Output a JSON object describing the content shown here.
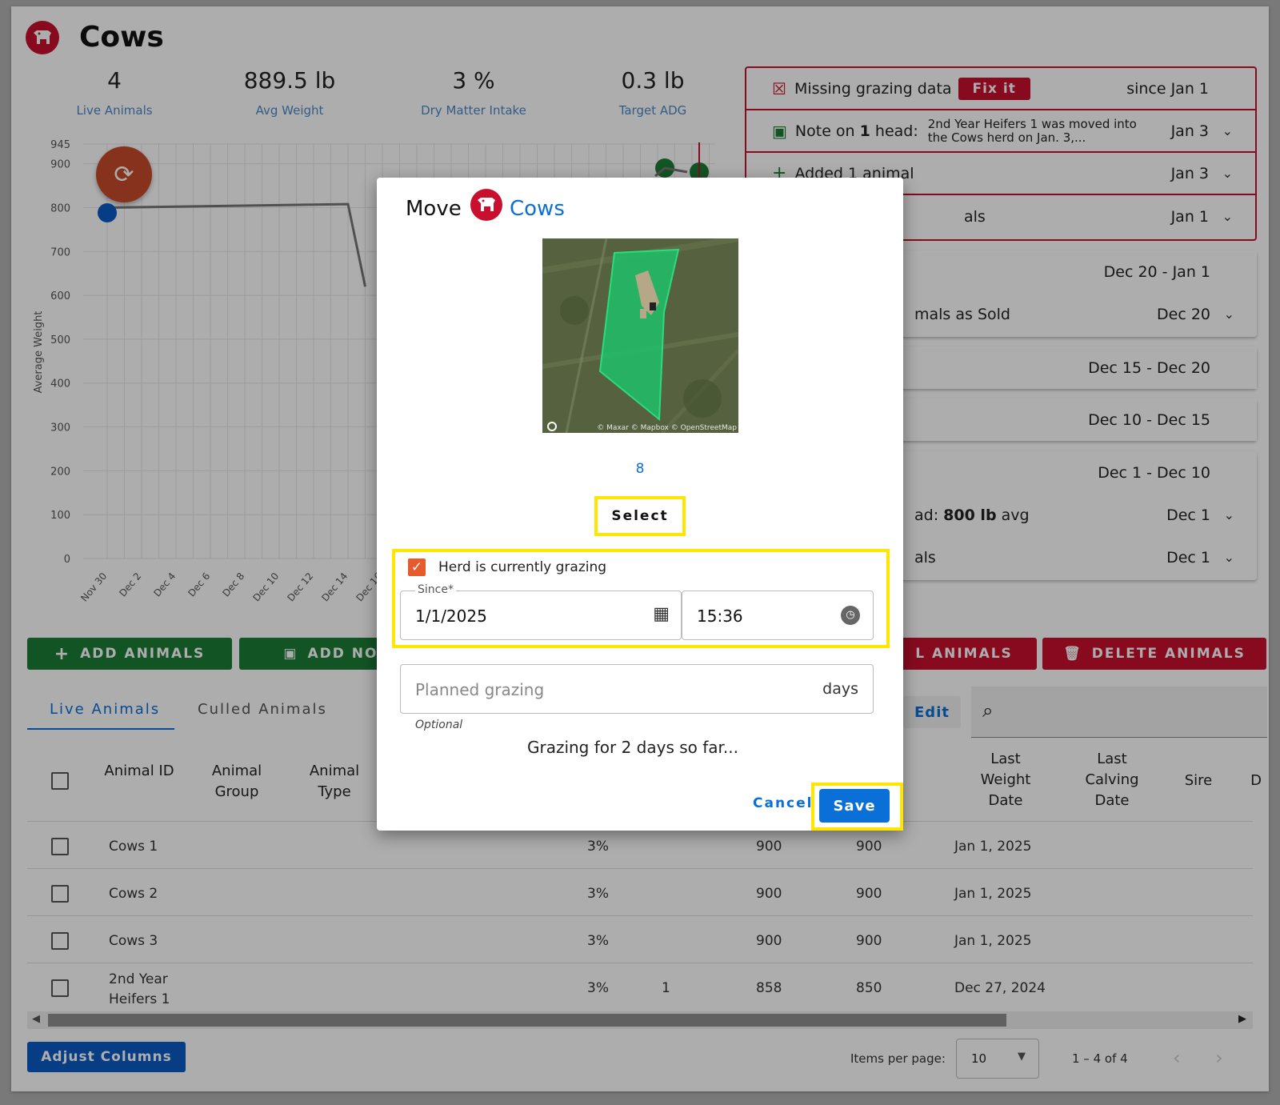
{
  "header": {
    "title": "Cows"
  },
  "stats": [
    {
      "value": "4",
      "label": "Live Animals"
    },
    {
      "value": "889.5 lb",
      "label": "Avg Weight"
    },
    {
      "value": "3 %",
      "label": "Dry Matter Intake"
    },
    {
      "value": "0.3 lb",
      "label": "Target ADG"
    }
  ],
  "chart": {
    "ylabel": "Average Weight",
    "yticks": [
      "945",
      "900",
      "800",
      "700",
      "600",
      "500",
      "400",
      "300",
      "200",
      "100",
      "0"
    ],
    "xticks": [
      "Nov 30",
      "Dec 2",
      "Dec 4",
      "Dec 6",
      "Dec 8",
      "Dec 10",
      "Dec 12",
      "Dec 14",
      "Dec 16"
    ]
  },
  "chart_data": {
    "type": "line",
    "ylabel": "Average Weight",
    "ylim": [
      0,
      945
    ],
    "x": [
      "Dec 1",
      "Dec 15",
      "Dec 16"
    ],
    "series": [
      {
        "values": [
          800,
          808,
          620
        ]
      }
    ]
  },
  "alerts": {
    "missing_label": "Missing grazing data",
    "fix_label": "Fix it",
    "missing_date": "since Jan 1",
    "note_prefix": "Note on ",
    "note_count": "1",
    "note_suffix": " head:",
    "note_text": "2nd Year Heifers 1 was moved into the Cows herd on Jan. 3,...",
    "note_date": "Jan 3",
    "added_label": "Added 1 animal",
    "added_date": "Jan 3",
    "row4_label": "als",
    "row4_date": "Jan 1"
  },
  "periods": [
    {
      "label": "",
      "date": "Dec 20 - Jan 1"
    },
    {
      "label": "mals as Sold",
      "date": "Dec 20"
    },
    {
      "label": "",
      "date": "Dec 15 - Dec 20"
    },
    {
      "label": "",
      "date": "Dec 10 - Dec 15"
    },
    {
      "label": "",
      "date": "Dec 1 - Dec 10"
    },
    {
      "label_pre": "ad: ",
      "label_bold": "800 lb",
      "label_post": " avg",
      "date": "Dec 1"
    },
    {
      "label": "als",
      "date": "Dec 1"
    }
  ],
  "actions": {
    "add_animals": "ADD ANIMALS",
    "add_notes": "ADD NOTE",
    "cull_animals": "L ANIMALS",
    "delete_animals": "DELETE ANIMALS",
    "edit": "Edit"
  },
  "tabs": {
    "live": "Live Animals",
    "culled": "Culled Animals"
  },
  "table": {
    "headers": {
      "animal_id": "Animal ID",
      "animal_group": "Animal Group",
      "animal_type": "Animal Type",
      "last_weight_date": "Last Weight Date",
      "last_calving_date": "Last Calving Date",
      "sire": "Sire",
      "cut": "D"
    },
    "rows": [
      {
        "id": "Cows 1",
        "dmi": "3%",
        "count": "",
        "w1": "900",
        "w2": "900",
        "date": "Jan 1, 2025"
      },
      {
        "id": "Cows 2",
        "dmi": "3%",
        "count": "",
        "w1": "900",
        "w2": "900",
        "date": "Jan 1, 2025"
      },
      {
        "id": "Cows 3",
        "dmi": "3%",
        "count": "",
        "w1": "900",
        "w2": "900",
        "date": "Jan 1, 2025"
      },
      {
        "id": "2nd Year Heifers 1",
        "dmi": "3%",
        "count": "1",
        "w1": "858",
        "w2": "850",
        "date": "Dec 27, 2024"
      }
    ]
  },
  "footer": {
    "adjust_columns": "Adjust Columns",
    "items_per_page_label": "Items per page:",
    "items_per_page": "10",
    "range": "1 – 4 of 4"
  },
  "dialog": {
    "title_prefix": "Move",
    "herd_name": "Cows",
    "map_attribution": "© Maxar © Mapbox © OpenStreetMap",
    "pasture_number": "8",
    "select_label": "Select",
    "checkbox_label": "Herd is currently grazing",
    "since_label": "Since*",
    "since_date": "1/1/2025",
    "since_time": "15:36",
    "planned_placeholder": "Planned grazing",
    "planned_unit": "days",
    "optional_hint": "Optional",
    "grazing_status": "Grazing for 2 days so far...",
    "cancel_label": "Cancel",
    "save_label": "Save"
  },
  "colors": {
    "brand_red": "#c8102e",
    "green": "#1b7d35",
    "blue": "#0a6fd6",
    "highlight": "#ffe600"
  }
}
